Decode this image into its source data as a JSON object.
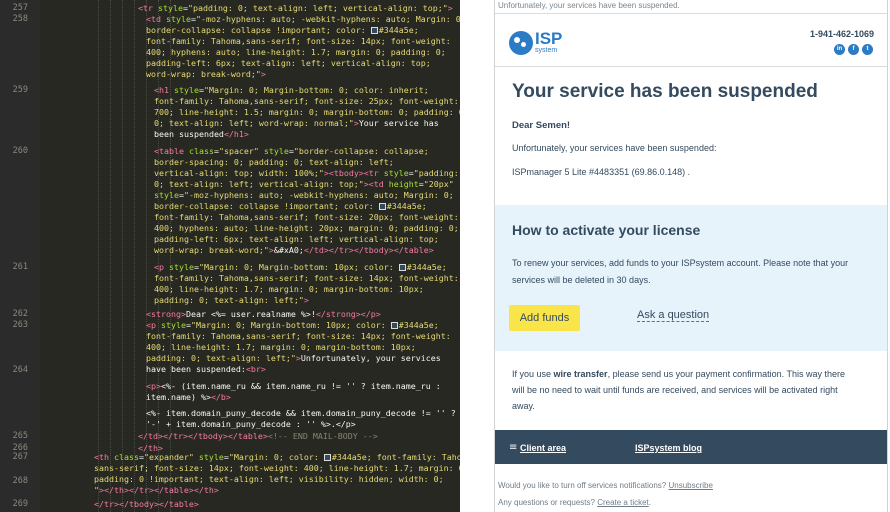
{
  "editor": {
    "line_numbers": [
      "257",
      "258",
      "259",
      "260",
      "261",
      "262",
      "263",
      "264",
      "265",
      "266",
      "267",
      "268",
      "269"
    ],
    "lines": [
      [
        {
          "c": "c-tag",
          "t": "<tr "
        },
        {
          "c": "c-attr",
          "t": "style"
        },
        {
          "c": "c-txt",
          "t": "="
        },
        {
          "c": "c-str",
          "t": "\"padding: 0; text-align: left; vertical-align: top;\""
        },
        {
          "c": "c-tag",
          "t": ">"
        }
      ],
      [
        {
          "c": "c-tag",
          "t": "<td "
        },
        {
          "c": "c-attr",
          "t": "style"
        },
        {
          "c": "c-txt",
          "t": "="
        },
        {
          "c": "c-str",
          "t": "\"-moz-hyphens: auto; -webkit-hyphens: auto; Margin: 0;"
        }
      ],
      [
        {
          "c": "c-str",
          "t": "border-collapse: collapse !important; color: "
        },
        {
          "c": "swatch",
          "t": ""
        },
        {
          "c": "c-str",
          "t": "#344a5e;"
        }
      ],
      [
        {
          "c": "c-str",
          "t": "font-family: Tahoma,sans-serif; font-size: 14px; font-weight:"
        }
      ],
      [
        {
          "c": "c-str",
          "t": "400; hyphens: auto; line-height: 1.7; margin: 0; padding: 0;"
        }
      ],
      [
        {
          "c": "c-str",
          "t": "padding-left: 6px; text-align: left; vertical-align: top;"
        }
      ],
      [
        {
          "c": "c-str",
          "t": "word-wrap: break-word;\""
        },
        {
          "c": "c-tag",
          "t": ">"
        }
      ],
      [
        {
          "c": "c-tag",
          "t": "<h1 "
        },
        {
          "c": "c-attr",
          "t": "style"
        },
        {
          "c": "c-txt",
          "t": "="
        },
        {
          "c": "c-str",
          "t": "\"Margin: 0; Margin-bottom: 0; color: inherit;"
        }
      ],
      [
        {
          "c": "c-str",
          "t": "font-family: Tahoma,sans-serif; font-size: 25px; font-weight:"
        }
      ],
      [
        {
          "c": "c-str",
          "t": "700; line-height: 1.5; margin: 0; margin-bottom: 0; padding: 0;"
        }
      ],
      [
        {
          "c": "c-str",
          "t": "0; text-align: left; word-wrap: normal;\""
        },
        {
          "c": "c-tag",
          "t": ">"
        },
        {
          "c": "c-txt",
          "t": "Your service has"
        }
      ],
      [
        {
          "c": "c-txt",
          "t": "been suspended"
        },
        {
          "c": "c-tag",
          "t": "</h1>"
        }
      ],
      [
        {
          "c": "c-tag",
          "t": "<table "
        },
        {
          "c": "c-attr",
          "t": "class"
        },
        {
          "c": "c-txt",
          "t": "="
        },
        {
          "c": "c-str",
          "t": "\"spacer\" "
        },
        {
          "c": "c-attr",
          "t": "style"
        },
        {
          "c": "c-txt",
          "t": "="
        },
        {
          "c": "c-str",
          "t": "\"border-collapse: collapse;"
        }
      ],
      [
        {
          "c": "c-str",
          "t": "border-spacing: 0; padding: 0; text-align: left;"
        }
      ],
      [
        {
          "c": "c-str",
          "t": "vertical-align: top; width: 100%;\""
        },
        {
          "c": "c-tag",
          "t": "><tbody><tr "
        },
        {
          "c": "c-attr",
          "t": "style"
        },
        {
          "c": "c-txt",
          "t": "="
        },
        {
          "c": "c-str",
          "t": "\"padding:"
        }
      ],
      [
        {
          "c": "c-str",
          "t": "0; text-align: left; vertical-align: top;\""
        },
        {
          "c": "c-tag",
          "t": "><td "
        },
        {
          "c": "c-attr",
          "t": "height"
        },
        {
          "c": "c-txt",
          "t": "="
        },
        {
          "c": "c-str",
          "t": "\"20px\""
        }
      ],
      [
        {
          "c": "c-attr",
          "t": "style"
        },
        {
          "c": "c-txt",
          "t": "="
        },
        {
          "c": "c-str",
          "t": "\"-moz-hyphens: auto; -webkit-hyphens: auto; Margin: 0;"
        }
      ],
      [
        {
          "c": "c-str",
          "t": "border-collapse: collapse !important; color: "
        },
        {
          "c": "swatch",
          "t": ""
        },
        {
          "c": "c-str",
          "t": "#344a5e;"
        }
      ],
      [
        {
          "c": "c-str",
          "t": "font-family: Tahoma,sans-serif; font-size: 20px; font-weight:"
        }
      ],
      [
        {
          "c": "c-str",
          "t": "400; hyphens: auto; line-height: 20px; margin: 0; padding: 0;"
        }
      ],
      [
        {
          "c": "c-str",
          "t": "padding-left: 6px; text-align: left; vertical-align: top;"
        }
      ],
      [
        {
          "c": "c-str",
          "t": "word-wrap: break-word;\""
        },
        {
          "c": "c-tag",
          "t": ">"
        },
        {
          "c": "c-txt",
          "t": "&#xA0;"
        },
        {
          "c": "c-tag",
          "t": "</td></tr></tbody></table>"
        }
      ],
      [
        {
          "c": "c-tag",
          "t": "<p "
        },
        {
          "c": "c-attr",
          "t": "style"
        },
        {
          "c": "c-txt",
          "t": "="
        },
        {
          "c": "c-str",
          "t": "\"Margin: 0; Margin-bottom: 10px; color: "
        },
        {
          "c": "swatch",
          "t": ""
        },
        {
          "c": "c-str",
          "t": "#344a5e;"
        }
      ],
      [
        {
          "c": "c-str",
          "t": "font-family: Tahoma,sans-serif; font-size: 14px; font-weight:"
        }
      ],
      [
        {
          "c": "c-str",
          "t": "400; line-height: 1.7; margin: 0; margin-bottom: 10px;"
        }
      ],
      [
        {
          "c": "c-str",
          "t": "padding: 0; text-align: left;\""
        },
        {
          "c": "c-tag",
          "t": ">"
        }
      ],
      [
        {
          "c": "c-tag",
          "t": "<strong>"
        },
        {
          "c": "c-txt",
          "t": "Dear <%= user.realname %>!"
        },
        {
          "c": "c-tag",
          "t": "</strong></p>"
        }
      ],
      [
        {
          "c": "c-tag",
          "t": "<p "
        },
        {
          "c": "c-attr",
          "t": "style"
        },
        {
          "c": "c-txt",
          "t": "="
        },
        {
          "c": "c-str",
          "t": "\"Margin: 0; Margin-bottom: 10px; color: "
        },
        {
          "c": "swatch",
          "t": ""
        },
        {
          "c": "c-str",
          "t": "#344a5e;"
        }
      ],
      [
        {
          "c": "c-str",
          "t": "font-family: Tahoma,sans-serif; font-size: 14px; font-weight:"
        }
      ],
      [
        {
          "c": "c-str",
          "t": "400; line-height: 1.7; margin: 0; margin-bottom: 10px;"
        }
      ],
      [
        {
          "c": "c-str",
          "t": "padding: 0; text-align: left;\""
        },
        {
          "c": "c-tag",
          "t": ">"
        },
        {
          "c": "c-txt",
          "t": "Unfortunately, your services"
        }
      ],
      [
        {
          "c": "c-txt",
          "t": "have been suspended:"
        },
        {
          "c": "c-tag",
          "t": "<br>"
        }
      ],
      [
        {
          "c": "c-tag",
          "t": "<p>"
        },
        {
          "c": "c-txt",
          "t": "<%- (item.name_ru && item.name_ru != '' ? item.name_ru :"
        }
      ],
      [
        {
          "c": "c-txt",
          "t": "item.name) %>"
        },
        {
          "c": "c-tag",
          "t": "</b>"
        }
      ],
      [
        {
          "c": "c-txt",
          "t": "<%- item.domain_puny_decode && item.domain_puny_decode != '' ?"
        }
      ],
      [
        {
          "c": "c-txt",
          "t": "'-' + item.domain_puny_decode : '' %>.</p>"
        }
      ],
      [
        {
          "c": "c-tag",
          "t": "</td></tr></tbody></table>"
        },
        {
          "c": "c-cmt",
          "t": "<!-- END MAIL-BODY -->"
        }
      ],
      [
        {
          "c": "c-tag",
          "t": "</th>"
        }
      ],
      [
        {
          "c": "c-tag",
          "t": "<th "
        },
        {
          "c": "c-attr",
          "t": "class"
        },
        {
          "c": "c-txt",
          "t": "="
        },
        {
          "c": "c-str",
          "t": "\"expander\" "
        },
        {
          "c": "c-attr",
          "t": "style"
        },
        {
          "c": "c-txt",
          "t": "="
        },
        {
          "c": "c-str",
          "t": "\"Margin: 0; color: "
        },
        {
          "c": "swatch",
          "t": ""
        },
        {
          "c": "c-str",
          "t": "#344a5e; font-family: Tahoma"
        }
      ],
      [
        {
          "c": "c-str",
          "t": "sans-serif; font-size: 14px; font-weight: 400; line-height: 1.7; margin: 0;"
        }
      ],
      [
        {
          "c": "c-str",
          "t": "padding: 0 !important; text-align: left; visibility: hidden; width: 0;"
        }
      ],
      [
        {
          "c": "c-str",
          "t": "\""
        },
        {
          "c": "c-tag",
          "t": "></th></tr></table></th>"
        }
      ],
      [
        {
          "c": "c-tag",
          "t": "</tr></tbody></table>"
        }
      ]
    ]
  },
  "email": {
    "top_note": "Unfortunately, your services have been suspended.",
    "logo_text": "ISP",
    "logo_sub": "system",
    "phone": "1-941-462-1069",
    "social_icons": [
      "in",
      "f",
      "t"
    ],
    "title": "Your service has been suspended",
    "greeting": "Dear Semen!",
    "intro": "Unfortunately, your services have been suspended:",
    "service_item": "ISPmanager 5 Lite #4483351 (69.86.0.148) .",
    "activate": {
      "title": "How to activate your license",
      "text_line1": "To renew your services, add funds to your ISPsystem account. Please note that your",
      "text_line2": "services will be deleted in 30 days.",
      "add_funds_label": "Add funds",
      "ask_label": "Ask a question"
    },
    "transfer": {
      "prefix": "If you use ",
      "bold": "wire transfer",
      "line1_rest": ", please send us your payment confirmation. This way there",
      "line2": "will be no need to wait until funds are received, and services will be activated right",
      "line3": "away."
    },
    "footer": {
      "client_area": "Client area",
      "blog": "ISPsystem blog"
    },
    "notify": {
      "question": "Would you like to turn off services notifications?",
      "unsubscribe": "Unsubscribe",
      "questions": "Any questions or requests?",
      "ticket": "Create a ticket"
    },
    "colors": {
      "accent": "#2b7bc5",
      "text": "#344a5e",
      "panel": "#e6f3fb",
      "button": "#f9e44a"
    }
  }
}
